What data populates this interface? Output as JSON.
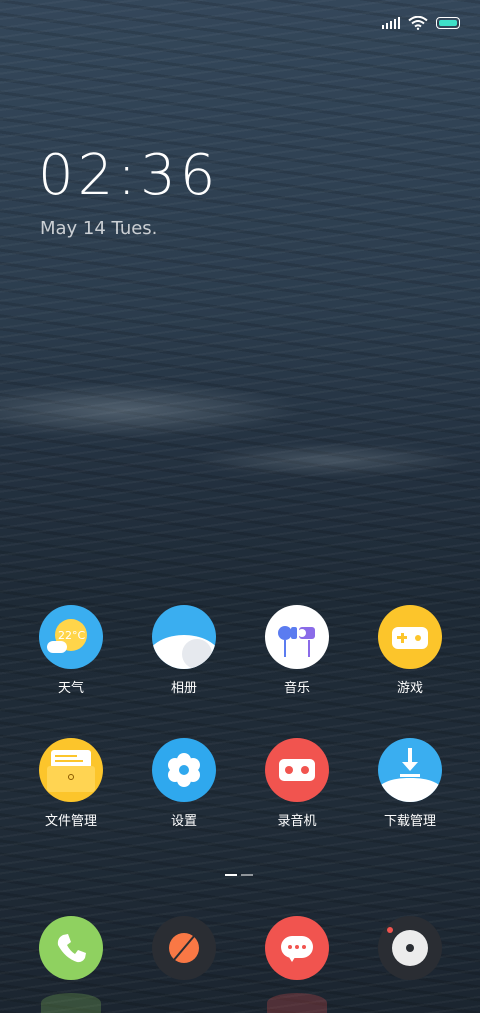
{
  "lockscreen": {
    "time": "02:36",
    "date": "May 14 Tues."
  },
  "status_bar": {
    "signal_icon": "signal-icon",
    "wifi_icon": "wifi-icon",
    "battery_icon": "battery-icon",
    "battery_color": "#3ee0c8"
  },
  "apps": [
    {
      "label": "天气",
      "icon": "weather-icon",
      "color": "#3aaef0",
      "badge_text": "22°C"
    },
    {
      "label": "相册",
      "icon": "gallery-icon",
      "color": "#3aaef0"
    },
    {
      "label": "音乐",
      "icon": "music-icon",
      "color": "#ffffff"
    },
    {
      "label": "游戏",
      "icon": "game-icon",
      "color": "#fcc52b"
    },
    {
      "label": "文件管理",
      "icon": "folder-icon",
      "color": "#fcc52b"
    },
    {
      "label": "设置",
      "icon": "settings-gear-icon",
      "color": "#2fa8ee"
    },
    {
      "label": "录音机",
      "icon": "recorder-icon",
      "color": "#f1544f"
    },
    {
      "label": "下载管理",
      "icon": "download-icon",
      "color": "#3aaef0"
    }
  ],
  "page_indicator": {
    "pages": 2,
    "current": 1
  },
  "dock": [
    {
      "icon": "phone-icon",
      "color": "#8fd160"
    },
    {
      "icon": "browser-icon",
      "color": "#2a2d33"
    },
    {
      "icon": "messages-icon",
      "color": "#f1544f"
    },
    {
      "icon": "camera-icon",
      "color": "#2a2d33"
    }
  ]
}
